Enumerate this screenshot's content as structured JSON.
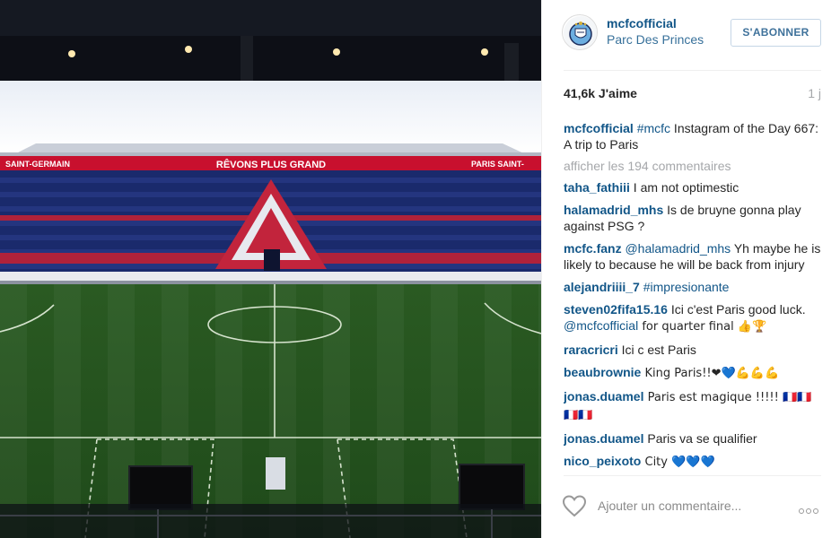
{
  "post": {
    "photo_alt": "Stadium photo",
    "banner_center": "RÊVONS PLUS GRAND",
    "banner_left": "SAINT-GERMAIN",
    "banner_right": "PARIS SAINT-"
  },
  "header": {
    "username": "mcfcofficial",
    "location": "Parc Des Princes",
    "follow_label": "S'ABONNER",
    "avatar_icon": "club-crest-icon"
  },
  "stats": {
    "likes": "41,6k J'aime",
    "age": "1 j"
  },
  "caption": {
    "user": "mcfcofficial",
    "hashtag": "#mcfc",
    "text": " Instagram of the Day 667: A trip to Paris"
  },
  "more_comments": "afficher les 194 commentaires",
  "comments": [
    {
      "user": "taha_fathiii",
      "mention": "",
      "text": " I am not optimestic"
    },
    {
      "user": "halamadrid_mhs",
      "mention": "",
      "text": " Is de bruyne gonna play against PSG ?"
    },
    {
      "user": "mcfc.fanz",
      "mention": " @halamadrid_mhs",
      "text": " Yh maybe he is likely to because he will be back from injury"
    },
    {
      "user": "alejandriiii_7",
      "mention": " #impresionante",
      "text": ""
    },
    {
      "user": "steven02fifa15.16",
      "mention": "",
      "text": " Ici c'est Paris good luck.",
      "mention2": "@mcfcofficial",
      "text2": " for quarter final 👍🏆"
    },
    {
      "user": "raracricri",
      "mention": "",
      "text": " Ici c est Paris"
    },
    {
      "user": "beaubrownie",
      "mention": "",
      "text": " King Paris!!❤💙💪💪💪"
    },
    {
      "user": "jonas.duamel",
      "mention": "",
      "text": " Paris est magique !!!!! 🇫🇷🇫🇷🇫🇷🇫🇷"
    },
    {
      "user": "jonas.duamel",
      "mention": "",
      "text": " Paris va se qualifier"
    },
    {
      "user": "nico_peixoto",
      "mention": "",
      "text": " City 💙💙💙"
    }
  ],
  "footer": {
    "like_icon": "heart-icon",
    "comment_placeholder": "Ajouter un commentaire...",
    "options_icon": "more-options-icon"
  },
  "colors": {
    "username": "#125688",
    "follow": "#3f729b",
    "muted": "#a5a7aa",
    "banner_red": "#c8102e",
    "seat_blue": "#1a2a6c",
    "pitch_green": "#2c5a24"
  }
}
